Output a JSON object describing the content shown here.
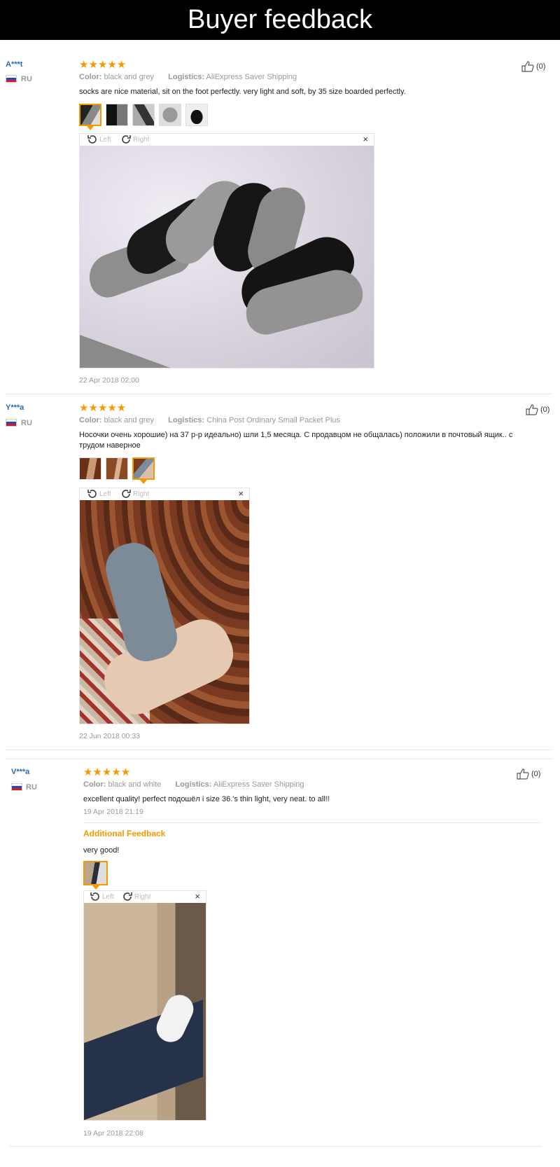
{
  "header": {
    "title": "Buyer feedback"
  },
  "reviews": [
    {
      "user": "A***t",
      "country": "RU",
      "stars": "★★★★★",
      "rating": 5,
      "like_count": "(0)",
      "color_label": "Color:",
      "color_value": "black and grey",
      "logistics_label": "Logistics:",
      "logistics_value": "AliExpress Saver Shipping",
      "text": "socks are nice material, sit on the foot perfectly. very light and soft, by 35 size boarded perfectly.",
      "viewer": {
        "left_label": "Left",
        "right_label": "Right",
        "close": "×"
      },
      "date": "22 Apr 2018 02:00"
    },
    {
      "user": "Y***a",
      "country": "RU",
      "stars": "★★★★★",
      "rating": 5,
      "like_count": "(0)",
      "color_label": "Color:",
      "color_value": "black and grey",
      "logistics_label": "Logistics:",
      "logistics_value": "China Post Ordinary Small Packet Plus",
      "text": "Носочки очень хорошие) на 37 р-р идеально) шли 1,5 месяца. С продавцом не общалась) положили в почтовый ящик.. с трудом наверное",
      "viewer": {
        "left_label": "Left",
        "right_label": "Right",
        "close": "×"
      },
      "date": "22 Jun 2018 00:33"
    },
    {
      "user": "V***a",
      "country": "RU",
      "stars": "★★★★★",
      "rating": 5,
      "like_count": "(0)",
      "color_label": "Color:",
      "color_value": "black and white",
      "logistics_label": "Logistics:",
      "logistics_value": "AliExpress Saver Shipping",
      "text": "excellent quality! perfect подошёл i size 36.'s thin light, very neat. to all!!",
      "date": "19 Apr 2018 21:19",
      "additional_title": "Additional Feedback",
      "additional_text": "very good!",
      "viewer": {
        "left_label": "Left",
        "right_label": "Right",
        "close": "×"
      },
      "additional_date": "19 Apr 2018 22:08"
    }
  ]
}
